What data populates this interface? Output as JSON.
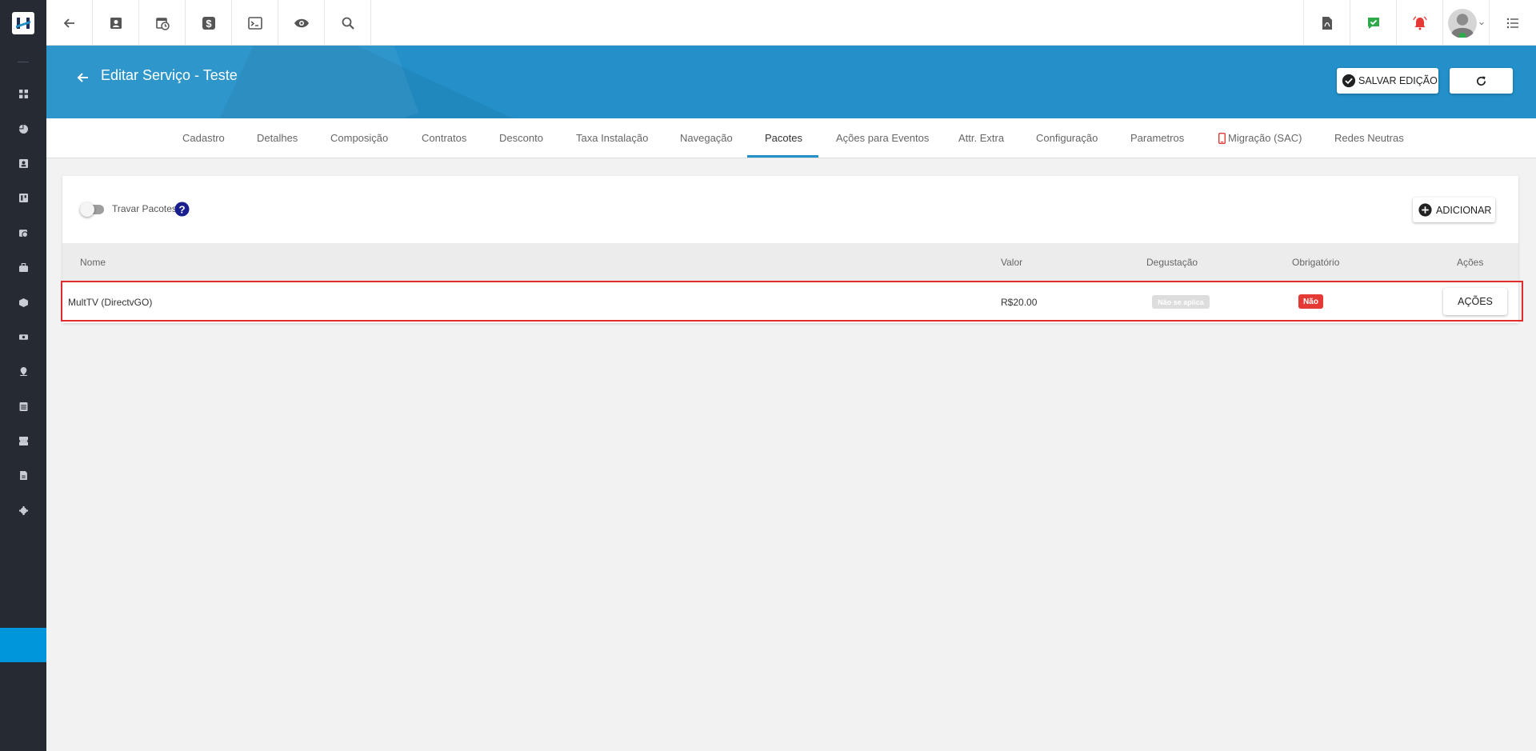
{
  "header": {
    "title": "Editar Serviço - Teste",
    "save_label": "SALVAR EDIÇÃO"
  },
  "tabs": [
    {
      "label": "Cadastro"
    },
    {
      "label": "Detalhes"
    },
    {
      "label": "Composição"
    },
    {
      "label": "Contratos"
    },
    {
      "label": "Desconto"
    },
    {
      "label": "Taxa Instalação"
    },
    {
      "label": "Navegação"
    },
    {
      "label": "Pacotes",
      "active": true
    },
    {
      "label": "Ações para Eventos"
    },
    {
      "label": "Attr. Extra"
    },
    {
      "label": "Configuração"
    },
    {
      "label": "Parametros"
    },
    {
      "label": "Migração (SAC)"
    },
    {
      "label": "Redes Neutras"
    }
  ],
  "toolbar": {
    "lock_label": "Travar Pacotes",
    "add_label": "ADICIONAR"
  },
  "table": {
    "columns": [
      "Nome",
      "Valor",
      "Degustação",
      "Obrigatório",
      "Ações"
    ],
    "rows": [
      {
        "nome": "MultTV (DirectvGO)",
        "valor": "R$20.00",
        "degustacao": "Não se aplica",
        "obrigatorio": "Não",
        "acoes": "AÇÕES"
      }
    ]
  },
  "colors": {
    "brand": "#2390c9",
    "sidebar": "#262a33",
    "active_sidebar": "#0096dc",
    "danger": "#e53935"
  }
}
